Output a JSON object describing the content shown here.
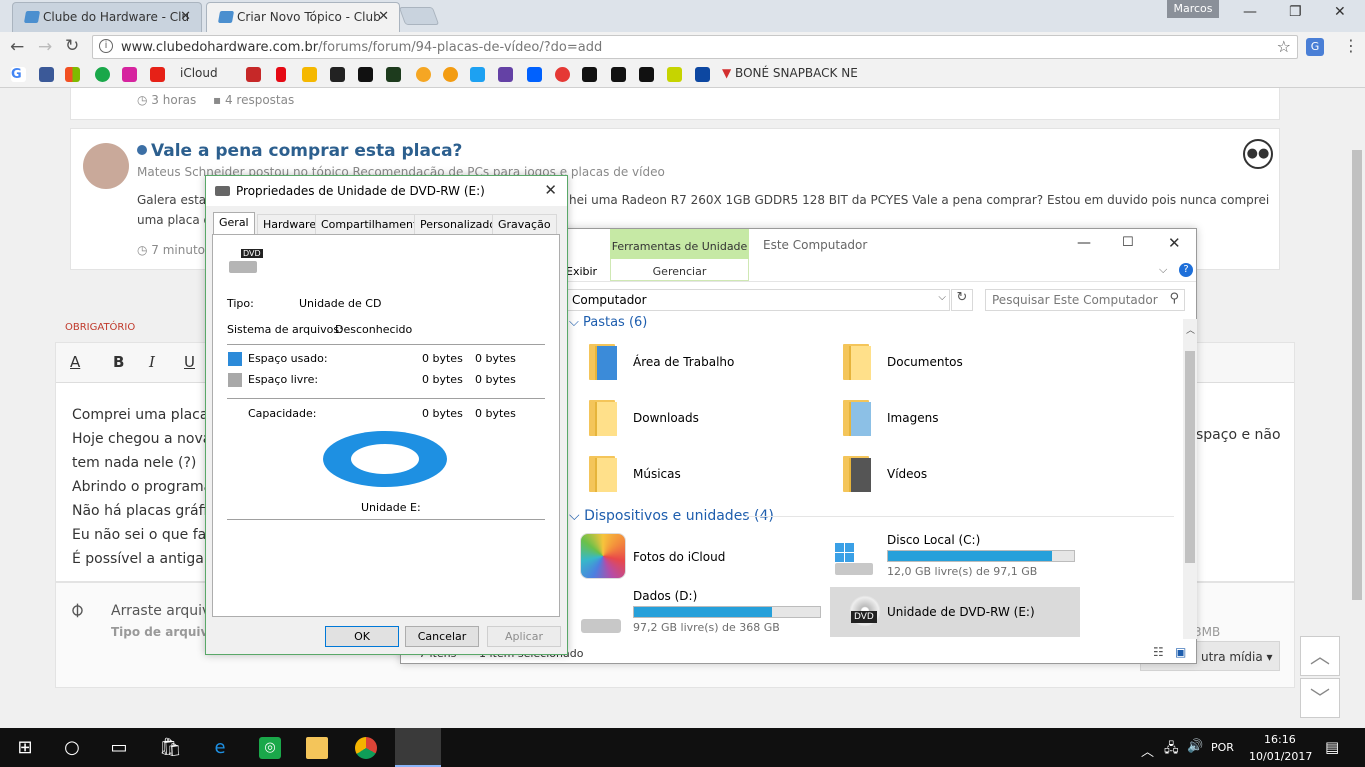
{
  "browser": {
    "tabs": [
      {
        "title": "Clube do Hardware - Clu"
      },
      {
        "title": "Criar Novo Tópico - Club"
      }
    ],
    "profile": "Marcos",
    "url_host": "www.clubedohardware.com.br",
    "url_path": "/forums/forum/94-placas-de-vídeo/?do=add",
    "bookmarks": [
      {
        "label": "iCloud"
      },
      {
        "label": "BONÉ SNAPBACK NE"
      }
    ]
  },
  "forum": {
    "prev_meta": {
      "time": "3 horas",
      "replies": "4 respostas"
    },
    "topic": {
      "title": "Vale a pena comprar esta placa?",
      "byline": "Mateus Schneider postou no tópico Recomendação de PCs para jogos e placas de vídeo",
      "body_left": "Galera esta",
      "body_right": "hei uma Radeon R7 260X 1GB GDDR5 128 BIT da PCYES Vale a pena comprar? Estou em duvido pois nunca comprei",
      "body_line2": "uma placa d",
      "time": "7 minutos"
    },
    "required_label": "OBRIGATÓRIO",
    "editor_lines": [
      "Comprei uma placa d",
      "Hoje chegou a nova,",
      "tem nada nele (?)",
      "Abrindo o programa d",
      "Não há placas gráfic",
      "Eu não sei o que faz",
      "É possível a antiga p"
    ],
    "editor_right": "spaço e não",
    "attach_text": "Arraste arquiv",
    "attach_types": "Tipo de arquivo",
    "attach_size": "3MB",
    "more_media": "utra mídia ▾"
  },
  "dialog": {
    "title": "Propriedades de Unidade de DVD-RW (E:)",
    "tabs": [
      "Geral",
      "Hardware",
      "Compartilhamento",
      "Personalizado",
      "Gravação"
    ],
    "tipo_label": "Tipo:",
    "tipo_value": "Unidade de CD",
    "fs_label": "Sistema de arquivos:",
    "fs_value": "Desconhecido",
    "used_label": "Espaço usado:",
    "used_bytes": "0 bytes",
    "used_bytes2": "0 bytes",
    "free_label": "Espaço livre:",
    "free_bytes": "0 bytes",
    "free_bytes2": "0 bytes",
    "cap_label": "Capacidade:",
    "cap_bytes": "0 bytes",
    "cap_bytes2": "0 bytes",
    "drive_label": "Unidade E:",
    "ok": "OK",
    "cancel": "Cancelar",
    "apply": "Aplicar",
    "dvd_badge": "DVD"
  },
  "explorer": {
    "ribbon_tab_tools": "Ferramentas de Unidade",
    "ribbon_manage": "Gerenciar",
    "window_title": "Este Computador",
    "view_tab": "Exibir",
    "address": "Computador",
    "search_placeholder": "Pesquisar Este Computador",
    "folders_header": "Pastas (6)",
    "folders": [
      "Área de Trabalho",
      "Documentos",
      "Downloads",
      "Imagens",
      "Músicas",
      "Vídeos"
    ],
    "devices_header": "Dispositivos e unidades (4)",
    "icloud_photos": "Fotos do iCloud",
    "disk_c": {
      "name": "Disco Local (C:)",
      "free": "12,0 GB livre(s) de 97,1 GB",
      "used_fraction": 0.88
    },
    "disk_d": {
      "name": "Dados (D:)",
      "free": "97,2 GB livre(s) de 368 GB",
      "used_fraction": 0.74
    },
    "dvd_e": {
      "name": "Unidade de DVD-RW (E:)",
      "badge": "DVD"
    },
    "status_items": "7 itens",
    "status_selected": "1 item selecionado"
  },
  "taskbar": {
    "lang": "POR",
    "time": "16:16",
    "date": "10/01/2017"
  }
}
